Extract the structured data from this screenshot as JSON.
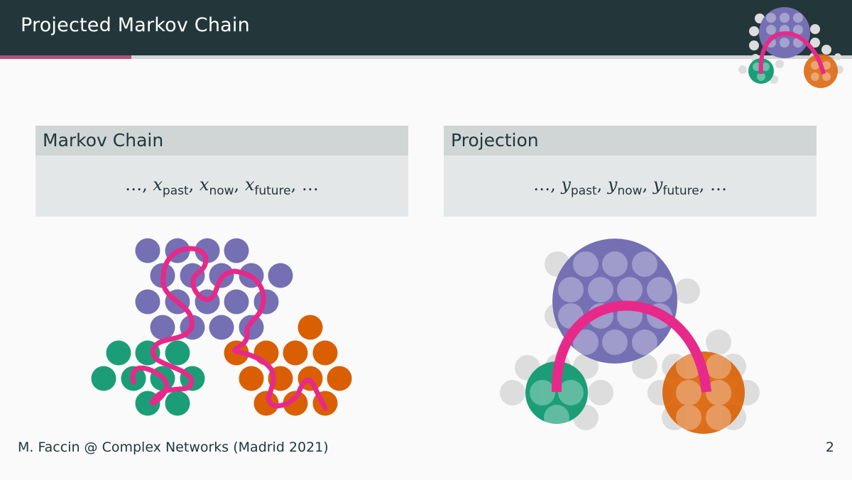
{
  "slide": {
    "title": "Projected Markov Chain",
    "progress_fraction": 0.154
  },
  "left_block": {
    "title": "Markov Chain",
    "formula": {
      "prefix": "…,",
      "terms": [
        {
          "var": "x",
          "sub": "past"
        },
        {
          "var": "x",
          "sub": "now"
        },
        {
          "var": "x",
          "sub": "future"
        }
      ],
      "suffix": "…"
    }
  },
  "right_block": {
    "title": "Projection",
    "formula": {
      "prefix": "…,",
      "terms": [
        {
          "var": "y",
          "sub": "past"
        },
        {
          "var": "y",
          "sub": "now"
        },
        {
          "var": "y",
          "sub": "future"
        }
      ],
      "suffix": "…"
    }
  },
  "colors": {
    "topbar": "#23373b",
    "progress": "#b2517c",
    "purple": "#7570b3",
    "green": "#1b9e77",
    "orange": "#d95f02",
    "path": "#e7298a",
    "grey_node": "#dddddd"
  },
  "footer": {
    "text": "M. Faccin @ Complex Networks (Madrid 2021)",
    "page": "2"
  }
}
